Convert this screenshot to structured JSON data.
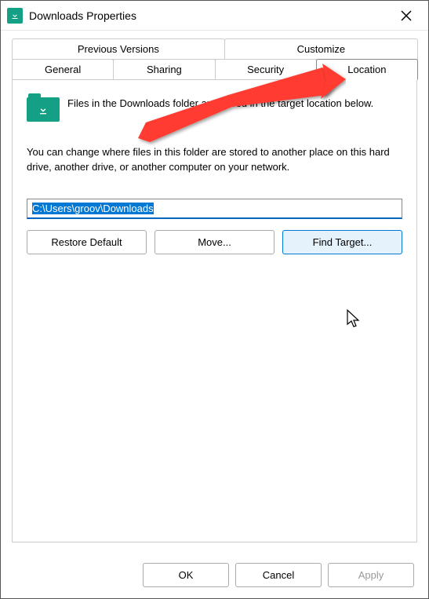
{
  "titlebar": {
    "title": "Downloads Properties"
  },
  "tabs": {
    "row1": [
      {
        "label": "Previous Versions"
      },
      {
        "label": "Customize"
      }
    ],
    "row2": [
      {
        "label": "General"
      },
      {
        "label": "Sharing"
      },
      {
        "label": "Security"
      },
      {
        "label": "Location",
        "active": true
      }
    ]
  },
  "location": {
    "icon_name": "download-folder-icon",
    "intro": "Files in the Downloads folder are stored in the target location below.",
    "description": "You can change where files in this folder are stored to another place on this hard drive, another drive, or another computer on your network.",
    "path": "C:\\Users\\groov\\Downloads",
    "buttons": {
      "restore": "Restore Default",
      "move": "Move...",
      "find": "Find Target..."
    }
  },
  "footer": {
    "ok": "OK",
    "cancel": "Cancel",
    "apply": "Apply"
  }
}
